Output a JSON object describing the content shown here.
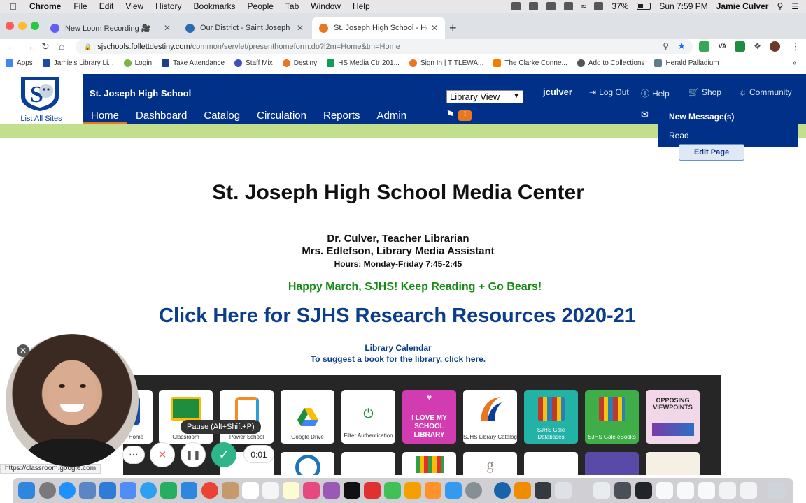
{
  "menubar": {
    "app": "Chrome",
    "items": [
      "File",
      "Edit",
      "View",
      "History",
      "Bookmarks",
      "People",
      "Tab",
      "Window",
      "Help"
    ],
    "battery": "37%",
    "clock": "Sun 7:59 PM",
    "user": "Jamie Culver"
  },
  "tabs": [
    {
      "title": "New Loom Recording 🎥",
      "favicon_color": "#625df5"
    },
    {
      "title": "Our District - Saint Joseph Pub",
      "favicon_color": "#2b6cb0"
    },
    {
      "title": "St. Joseph High School - Hom",
      "favicon_color": "#e87722"
    }
  ],
  "address": {
    "host": "sjschools.follettdestiny.com",
    "path": "/common/servlet/presenthomeform.do?l2m=Home&tm=Home"
  },
  "bookmarks": [
    {
      "label": "Apps",
      "color": "#4285f4"
    },
    {
      "label": "Jamie's Library Li...",
      "color": "#1a4da1"
    },
    {
      "label": "Login",
      "color": "#7cb342"
    },
    {
      "label": "Take Attendance",
      "color": "#1c3f8a"
    },
    {
      "label": "Staff Mix",
      "color": "#3f51b5"
    },
    {
      "label": "Destiny",
      "color": "#e87722"
    },
    {
      "label": "HS Media Ctr 201...",
      "color": "#0f9d58"
    },
    {
      "label": "Sign In | TITLEWA...",
      "color": "#e87722"
    },
    {
      "label": "The Clarke Conne...",
      "color": "#f57c00"
    },
    {
      "label": "Add to Collections",
      "color": "#555555"
    },
    {
      "label": "Herald Palladium",
      "color": "#607d8b"
    }
  ],
  "header": {
    "all_sites": "List All Sites",
    "school": "St. Joseph High School",
    "nav": [
      "Home",
      "Dashboard",
      "Catalog",
      "Circulation",
      "Reports",
      "Admin"
    ],
    "view_select": "Library View",
    "badge": "!",
    "username": "jculver",
    "logout": "Log Out",
    "help": "Help",
    "shop": "Shop",
    "community": "Community"
  },
  "messages": {
    "new": "New Message(s)",
    "read": "Read"
  },
  "edit_page": "Edit Page",
  "content": {
    "title": "St. Joseph High School Media Center",
    "staff1": "Dr. Culver, Teacher Librarian",
    "staff2": "Mrs. Edlefson, Library Media Assistant",
    "hours": "Hours: Monday-Friday 7:45-2:45",
    "greeting": "Happy March, SJHS! Keep Reading + Go Bears!",
    "research": "Click Here for SJHS Research Resources 2020-21",
    "calendar": "Library Calendar",
    "suggest": "To suggest a book for the library, click here."
  },
  "tiles": [
    {
      "label": "Home",
      "bg": "#ffffff"
    },
    {
      "label": "Classroom",
      "bg": "#ffffff"
    },
    {
      "label": "Power School",
      "bg": "#ffffff"
    },
    {
      "label": "Google Drive",
      "bg": "#ffffff"
    },
    {
      "label": "Filter Authentication",
      "bg": "#ffffff"
    },
    {
      "label": "I LOVE MY SCHOOL LIBRARY",
      "bg": "#d33cb0"
    },
    {
      "label": "SJHS Library Catalog",
      "bg": "#ffffff"
    },
    {
      "label": "SJHS Gale Databases",
      "bg": "#22b3a6"
    },
    {
      "label": "SJHS Gale eBooks",
      "bg": "#3fae49"
    },
    {
      "label": "OPPOSING VIEWPOINTS",
      "bg": "#f2d7e8"
    }
  ],
  "status_url": "https://classroom.google.com",
  "loom": {
    "tooltip": "Pause (Alt+Shift+P)",
    "timer": "0:01"
  }
}
